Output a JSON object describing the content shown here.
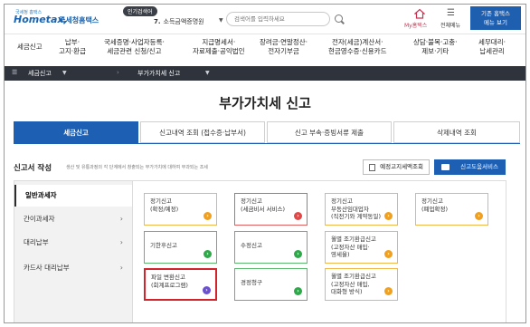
{
  "header": {
    "logo_small": "국세청 홈택스",
    "logo_brand": "Hometax,",
    "logo_brand_ko": "국세청홈택스",
    "popular_badge": "인기검색어",
    "popular_num": "7.",
    "popular_term": "소득금액증명원",
    "search_placeholder": "검색어를 입력하세요",
    "my_hometax": "My홈택스",
    "all_menu": "전체메뉴",
    "service_btn": [
      "기존 홈택스",
      "메뉴 보기"
    ]
  },
  "nav": [
    [
      "세금신고"
    ],
    [
      "납부·",
      "고지·환급"
    ],
    [
      "국세증명·사업자등록·",
      "세금관련 신청/신고"
    ],
    [
      "지급명세서·",
      "자료제출·공익법인"
    ],
    [
      "장려금·연말정산·",
      "전자기부금"
    ],
    [
      "전자(세금)계산서·",
      "현금영수증·신용카드"
    ],
    [
      "상담·불복·고충·",
      "제보·기타"
    ],
    [
      "세무대리·",
      "납세관리"
    ]
  ],
  "breadcrumb": {
    "root": "세금신고",
    "current": "부가가치세 신고"
  },
  "page_title": "부가가치세 신고",
  "tabs": [
    "세금신고",
    "신고내역 조회 (접수증·납부서)",
    "신고 부속·증빙서류 제출",
    "삭제내역 조회"
  ],
  "section": {
    "title": "신고서 작성",
    "desc": "생산 및 유통과정의 각 단계에서 창출되는 부가가치에 대하여 부과되는 조세",
    "notice_btn": "예정고지세액조회",
    "help_btn": "신고도움서비스"
  },
  "side_menu": [
    "일반과세자",
    "간이과세자",
    "대리납부",
    "카드사 대리납부"
  ],
  "cards": [
    [
      "정기신고",
      "(확정/예정)"
    ],
    [
      "정기신고",
      "(세금비서 서비스)"
    ],
    [
      "정기신고",
      "부동산임대업자",
      "(직전기와 계약동일)"
    ],
    [
      "정기신고",
      "(폐업확정)"
    ],
    [
      "기한후신고"
    ],
    [
      "수정신고"
    ],
    [
      "월별 조기환급신고",
      "(고정자산 매입·",
      "영세율)"
    ],
    [
      "파일 변환신고",
      "(회계프로그램)"
    ],
    [
      "경정청구"
    ],
    [
      "월별 조기환급신고",
      "(고정자산 매입,",
      "대화형 방식)"
    ]
  ],
  "colors": {
    "accent": "#1d5fb3",
    "breadcrumb_bg": "#2e333c",
    "highlight": "#d3232b"
  }
}
